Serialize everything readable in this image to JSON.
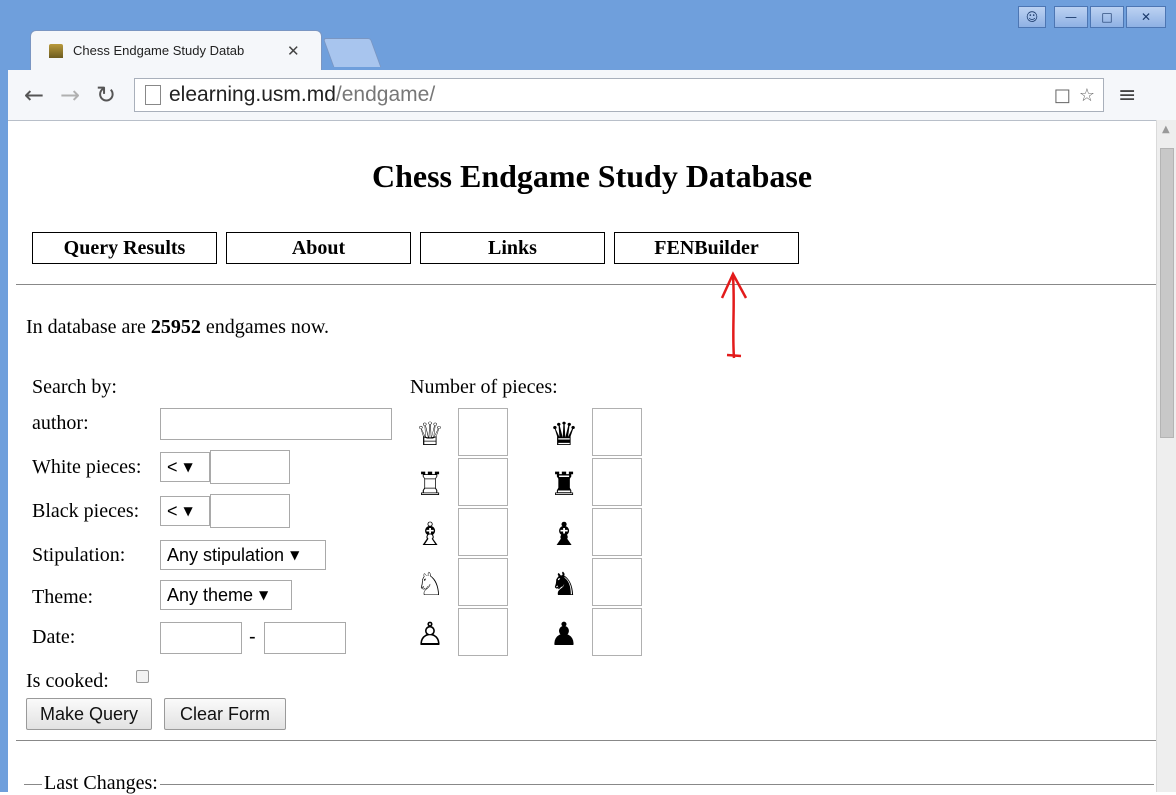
{
  "browser": {
    "tab_title": "Chess Endgame Study Datab",
    "url_host": "elearning.usm.md",
    "url_path": "/endgame/",
    "window_buttons": [
      "person-icon",
      "minimize-icon",
      "maximize-icon",
      "close-icon"
    ]
  },
  "page": {
    "title": "Chess Endgame Study Database",
    "nav": [
      "Query Results",
      "About",
      "Links",
      "FENBuilder"
    ],
    "info_prefix": "In database are ",
    "info_count": "25952",
    "info_suffix": " endgames now."
  },
  "form": {
    "search_by": "Search by:",
    "author_label": "author:",
    "author_value": "",
    "white_label": "White pieces:",
    "white_op": "<",
    "white_value": "",
    "black_label": "Black pieces:",
    "black_op": "<",
    "black_value": "",
    "stipulation_label": "Stipulation:",
    "stipulation_value": "Any stipulation",
    "theme_label": "Theme:",
    "theme_value": "Any theme",
    "date_label": "Date:",
    "date_sep": "-",
    "cooked_label": "Is cooked:",
    "make_query": "Make Query",
    "clear_form": "Clear Form"
  },
  "pieces": {
    "label": "Number of pieces:",
    "white": [
      "white-queen-icon",
      "white-rook-icon",
      "white-bishop-icon",
      "white-knight-icon",
      "white-pawn-icon"
    ],
    "black": [
      "black-queen-icon",
      "black-rook-icon",
      "black-bishop-icon",
      "black-knight-icon",
      "black-pawn-icon"
    ]
  },
  "last_changes_label": "Last Changes:",
  "annotation_color": "#e31b1b"
}
